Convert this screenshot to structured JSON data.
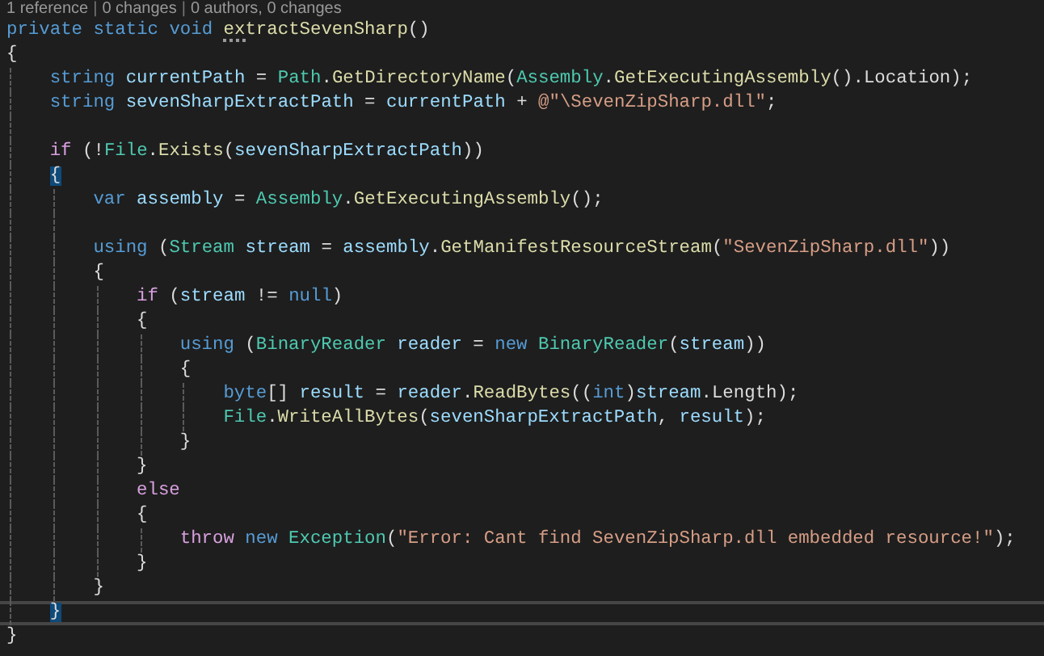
{
  "codelens": [
    {
      "text": "1 reference",
      "kind": "link"
    },
    {
      "text": "|",
      "kind": "separator"
    },
    {
      "text": "0 changes",
      "kind": "link"
    },
    {
      "text": "|",
      "kind": "separator"
    },
    {
      "text": "0 authors, 0 changes",
      "kind": "link"
    }
  ],
  "lines": [
    {
      "current": false,
      "brace_matched": false,
      "tokens": [
        {
          "text": "private static void ",
          "kind": "keyword"
        },
        {
          "text": "extractSevenSharp",
          "kind": "method",
          "suggestion": true
        },
        {
          "text": "()",
          "kind": "plain"
        }
      ]
    },
    {
      "current": false,
      "brace_matched": false,
      "tokens": [
        {
          "text": "{",
          "kind": "plain"
        }
      ]
    },
    {
      "current": false,
      "brace_matched": false,
      "tokens": [
        {
          "text": "    string ",
          "kind": "keyword"
        },
        {
          "text": "currentPath",
          "kind": "variable"
        },
        {
          "text": " = ",
          "kind": "plain"
        },
        {
          "text": "Path",
          "kind": "type"
        },
        {
          "text": ".",
          "kind": "plain"
        },
        {
          "text": "GetDirectoryName",
          "kind": "method"
        },
        {
          "text": "(",
          "kind": "plain"
        },
        {
          "text": "Assembly",
          "kind": "type"
        },
        {
          "text": ".",
          "kind": "plain"
        },
        {
          "text": "GetExecutingAssembly",
          "kind": "method"
        },
        {
          "text": "().Location);",
          "kind": "plain"
        }
      ]
    },
    {
      "current": false,
      "brace_matched": false,
      "tokens": [
        {
          "text": "    string ",
          "kind": "keyword"
        },
        {
          "text": "sevenSharpExtractPath",
          "kind": "variable"
        },
        {
          "text": " = ",
          "kind": "plain"
        },
        {
          "text": "currentPath",
          "kind": "variable"
        },
        {
          "text": " + ",
          "kind": "plain"
        },
        {
          "text": "@\"\\SevenZipSharp.dll\"",
          "kind": "string"
        },
        {
          "text": ";",
          "kind": "plain"
        }
      ]
    },
    {
      "current": false,
      "brace_matched": false
    },
    {
      "current": false,
      "brace_matched": false,
      "tokens": [
        {
          "text": "    if",
          "kind": "control"
        },
        {
          "text": " (!",
          "kind": "plain"
        },
        {
          "text": "File",
          "kind": "type"
        },
        {
          "text": ".",
          "kind": "plain"
        },
        {
          "text": "Exists",
          "kind": "method"
        },
        {
          "text": "(",
          "kind": "plain"
        },
        {
          "text": "sevenSharpExtractPath",
          "kind": "variable"
        },
        {
          "text": "))",
          "kind": "plain"
        }
      ]
    },
    {
      "current": false,
      "brace_matched": true,
      "tokens": [
        {
          "text": "    {",
          "kind": "plain"
        }
      ]
    },
    {
      "current": false,
      "brace_matched": false,
      "tokens": [
        {
          "text": "        var ",
          "kind": "keyword"
        },
        {
          "text": "assembly",
          "kind": "variable"
        },
        {
          "text": " = ",
          "kind": "plain"
        },
        {
          "text": "Assembly",
          "kind": "type"
        },
        {
          "text": ".",
          "kind": "plain"
        },
        {
          "text": "GetExecutingAssembly",
          "kind": "method"
        },
        {
          "text": "();",
          "kind": "plain"
        }
      ]
    },
    {
      "current": false,
      "brace_matched": false
    },
    {
      "current": false,
      "brace_matched": false,
      "tokens": [
        {
          "text": "        using",
          "kind": "keyword"
        },
        {
          "text": " (",
          "kind": "plain"
        },
        {
          "text": "Stream",
          "kind": "type"
        },
        {
          "text": " stream",
          "kind": "variable"
        },
        {
          "text": " = ",
          "kind": "plain"
        },
        {
          "text": "assembly",
          "kind": "variable"
        },
        {
          "text": ".",
          "kind": "plain"
        },
        {
          "text": "GetManifestResourceStream",
          "kind": "method"
        },
        {
          "text": "(",
          "kind": "plain"
        },
        {
          "text": "\"SevenZipSharp.dll\"",
          "kind": "string"
        },
        {
          "text": "))",
          "kind": "plain"
        }
      ]
    },
    {
      "current": false,
      "brace_matched": false,
      "tokens": [
        {
          "text": "        {",
          "kind": "plain"
        }
      ]
    },
    {
      "current": false,
      "brace_matched": false,
      "tokens": [
        {
          "text": "            if",
          "kind": "control"
        },
        {
          "text": " (",
          "kind": "plain"
        },
        {
          "text": "stream",
          "kind": "variable"
        },
        {
          "text": " != ",
          "kind": "plain"
        },
        {
          "text": "null",
          "kind": "keyword"
        },
        {
          "text": ")",
          "kind": "plain"
        }
      ]
    },
    {
      "current": false,
      "brace_matched": false,
      "tokens": [
        {
          "text": "            {",
          "kind": "plain"
        }
      ]
    },
    {
      "current": false,
      "brace_matched": false,
      "tokens": [
        {
          "text": "                using",
          "kind": "keyword"
        },
        {
          "text": " (",
          "kind": "plain"
        },
        {
          "text": "BinaryReader",
          "kind": "type"
        },
        {
          "text": " reader",
          "kind": "variable"
        },
        {
          "text": " = ",
          "kind": "plain"
        },
        {
          "text": "new ",
          "kind": "keyword"
        },
        {
          "text": "BinaryReader",
          "kind": "type"
        },
        {
          "text": "(",
          "kind": "plain"
        },
        {
          "text": "stream",
          "kind": "variable"
        },
        {
          "text": "))",
          "kind": "plain"
        }
      ]
    },
    {
      "current": false,
      "brace_matched": false,
      "tokens": [
        {
          "text": "                {",
          "kind": "plain"
        }
      ]
    },
    {
      "current": false,
      "brace_matched": false,
      "tokens": [
        {
          "text": "                    byte",
          "kind": "keyword"
        },
        {
          "text": "[] ",
          "kind": "plain"
        },
        {
          "text": "result",
          "kind": "variable"
        },
        {
          "text": " = ",
          "kind": "plain"
        },
        {
          "text": "reader",
          "kind": "variable"
        },
        {
          "text": ".",
          "kind": "plain"
        },
        {
          "text": "ReadBytes",
          "kind": "method"
        },
        {
          "text": "((",
          "kind": "plain"
        },
        {
          "text": "int",
          "kind": "keyword"
        },
        {
          "text": ")",
          "kind": "plain"
        },
        {
          "text": "stream",
          "kind": "variable"
        },
        {
          "text": ".Length);",
          "kind": "plain"
        }
      ]
    },
    {
      "current": false,
      "brace_matched": false,
      "tokens": [
        {
          "text": "                    File",
          "kind": "type"
        },
        {
          "text": ".",
          "kind": "plain"
        },
        {
          "text": "WriteAllBytes",
          "kind": "method"
        },
        {
          "text": "(",
          "kind": "plain"
        },
        {
          "text": "sevenSharpExtractPath",
          "kind": "variable"
        },
        {
          "text": ", ",
          "kind": "plain"
        },
        {
          "text": "result",
          "kind": "variable"
        },
        {
          "text": ");",
          "kind": "plain"
        }
      ]
    },
    {
      "current": false,
      "brace_matched": false,
      "tokens": [
        {
          "text": "                }",
          "kind": "plain"
        }
      ]
    },
    {
      "current": false,
      "brace_matched": false,
      "tokens": [
        {
          "text": "            }",
          "kind": "plain"
        }
      ]
    },
    {
      "current": false,
      "brace_matched": false,
      "tokens": [
        {
          "text": "            else",
          "kind": "control"
        }
      ]
    },
    {
      "current": false,
      "brace_matched": false,
      "tokens": [
        {
          "text": "            {",
          "kind": "plain"
        }
      ]
    },
    {
      "current": false,
      "brace_matched": false,
      "tokens": [
        {
          "text": "                throw ",
          "kind": "control"
        },
        {
          "text": "new ",
          "kind": "keyword"
        },
        {
          "text": "Exception",
          "kind": "type"
        },
        {
          "text": "(",
          "kind": "plain"
        },
        {
          "text": "\"Error: Cant find SevenZipSharp.dll embedded resource!\"",
          "kind": "string"
        },
        {
          "text": ");",
          "kind": "plain"
        }
      ]
    },
    {
      "current": false,
      "brace_matched": false,
      "tokens": [
        {
          "text": "            }",
          "kind": "plain"
        }
      ]
    },
    {
      "current": false,
      "brace_matched": false,
      "tokens": [
        {
          "text": "        }",
          "kind": "plain"
        }
      ]
    },
    {
      "current": true,
      "brace_matched": true,
      "tokens": [
        {
          "text": "    }",
          "kind": "plain"
        }
      ]
    },
    {
      "current": false,
      "brace_matched": false,
      "tokens": [
        {
          "text": "}",
          "kind": "plain"
        }
      ]
    }
  ]
}
